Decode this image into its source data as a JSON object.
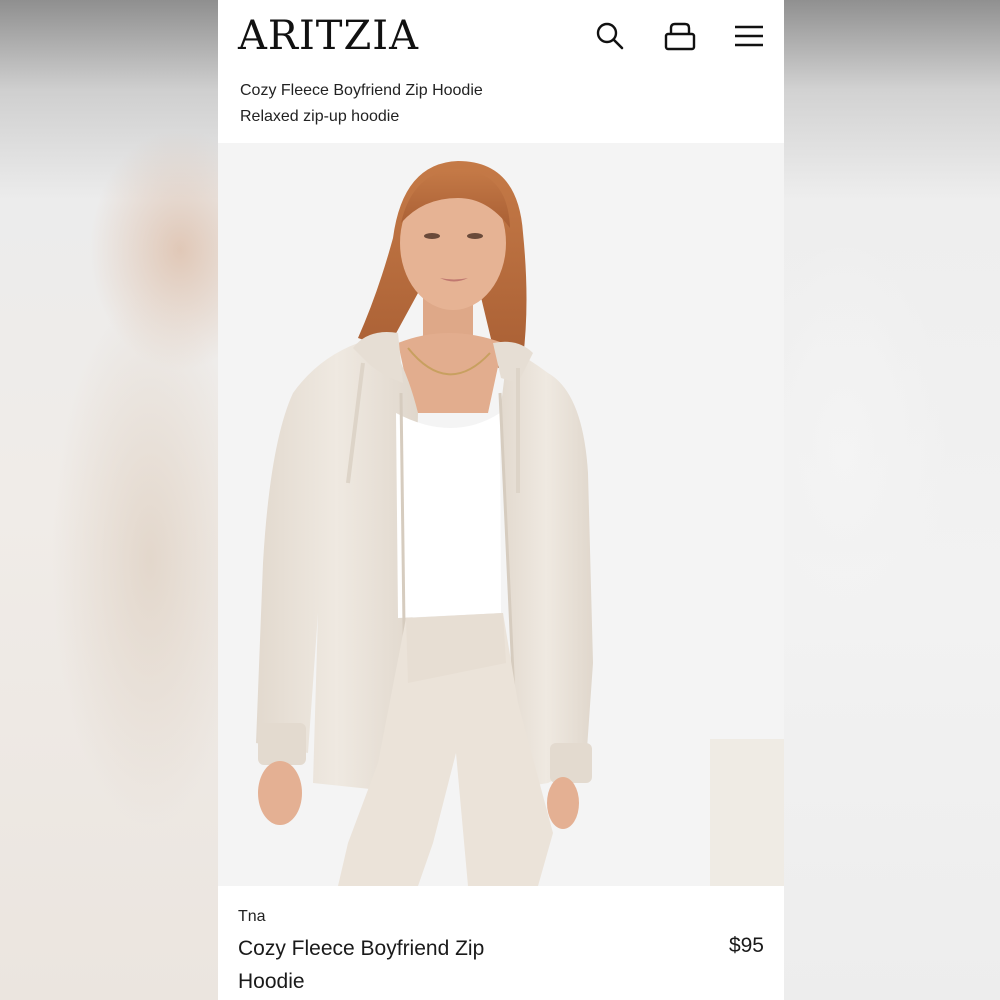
{
  "header": {
    "logo": "ARITZIA",
    "icons": [
      "search-icon",
      "shopping-bag-icon",
      "menu-icon"
    ]
  },
  "subtitle": {
    "line1": "Cozy Fleece Boyfriend Zip Hoodie",
    "line2": "Relaxed zip-up hoodie"
  },
  "product": {
    "brand": "Tna",
    "name": "Cozy Fleece Boyfriend Zip Hoodie",
    "price": "$95"
  },
  "colors": {
    "hoodie": "#ebe4db",
    "tank": "#ffffff",
    "hair": "#b86a3e",
    "skin": "#e6b394",
    "image_background": "#f4f4f4"
  }
}
